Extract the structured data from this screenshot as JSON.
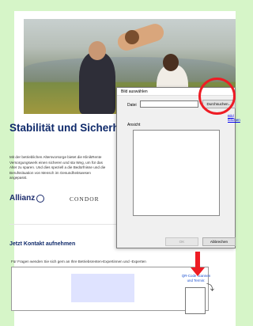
{
  "background": {
    "color": "#d6f5c8"
  },
  "hero": {
    "image": "family-photo"
  },
  "headline": "Stabilität und Sicherhe",
  "body_text": "Mit der betrieblichen Altersvorsorge bietet die KlinikRente Versorgungswerk einen sicheren und sta Weg, um für das Alter zu sparen. Und dies speziell a die Bedürfnisse und die Berufssituation von Mensch im Gesundheitswesen angepasst.",
  "logos": {
    "allianz": "Allianz",
    "condor": "CONDOR"
  },
  "contact": {
    "heading": "Jetzt Kontakt aufnehmen",
    "text": "Für Fragen wenden Sie sich gern an Ihre Betriebsrenten-Expertinnen und -Experten",
    "qr_label": "QR-Code scannen und Termin:"
  },
  "dialog": {
    "title": "Bild auswählen",
    "file_label": "Datei",
    "file_value": "",
    "browse_label": "Durchsuchen...",
    "clear_link": "Bild löschen",
    "preview_label": "Ansicht",
    "ok_label": "OK",
    "cancel_label": "Abbrechen"
  },
  "colors": {
    "headline": "#0f2a6b",
    "annotation": "#ee1c24",
    "link": "#0000ee"
  }
}
